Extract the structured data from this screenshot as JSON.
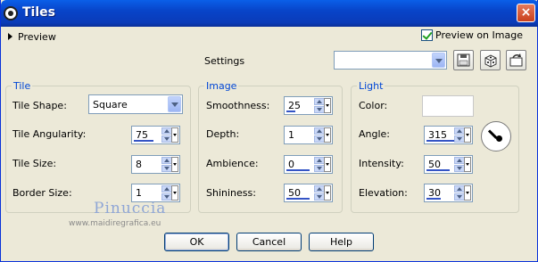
{
  "window": {
    "title": "Tiles",
    "close_glyph": "×",
    "app_icon": "app-icon"
  },
  "top": {
    "preview_label": "Preview",
    "preview_on_image_label": "Preview on Image",
    "preview_on_image_checked": true,
    "settings_label": "Settings",
    "settings_value": ""
  },
  "tile": {
    "title": "Tile",
    "shape_label": "Tile Shape:",
    "shape_value": "Square",
    "angularity_label": "Tile Angularity:",
    "angularity_value": "75",
    "size_label": "Tile Size:",
    "size_value": "8",
    "border_label": "Border Size:",
    "border_value": "1"
  },
  "image": {
    "title": "Image",
    "smoothness_label": "Smoothness:",
    "smoothness_value": "25",
    "depth_label": "Depth:",
    "depth_value": "1",
    "ambience_label": "Ambience:",
    "ambience_value": "0",
    "shininess_label": "Shininess:",
    "shininess_value": "50"
  },
  "light": {
    "title": "Light",
    "color_label": "Color:",
    "color_value": "#ffffff",
    "angle_label": "Angle:",
    "angle_value": "315",
    "intensity_label": "Intensity:",
    "intensity_value": "50",
    "elevation_label": "Elevation:",
    "elevation_value": "30"
  },
  "watermark": {
    "name": "Pinuccia",
    "url": "www.maidiregrafica.eu"
  },
  "buttons": {
    "ok": "OK",
    "cancel": "Cancel",
    "help": "Help"
  }
}
